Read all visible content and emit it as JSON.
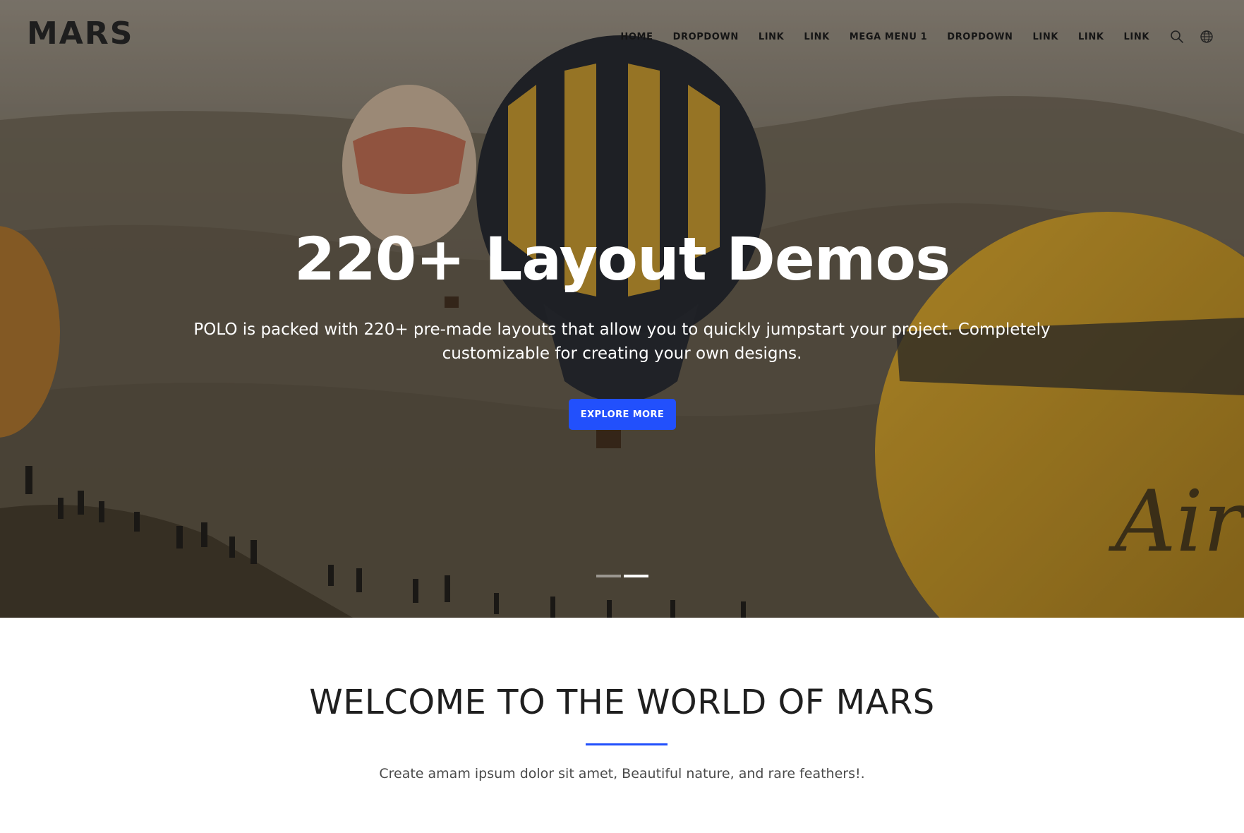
{
  "brand": {
    "logo": "MARS",
    "accent": "#2250fc"
  },
  "nav": {
    "items": [
      "HOME",
      "DROPDOWN",
      "LINK",
      "LINK",
      "MEGA MENU 1",
      "DROPDOWN",
      "LINK",
      "LINK",
      "LINK"
    ],
    "icons": [
      "search-icon",
      "globe-icon"
    ]
  },
  "hero": {
    "title": "220+ Layout Demos",
    "subtitle_line1": "POLO is packed with 220+ pre-made layouts that allow you to quickly jumpstart your project. Completely",
    "subtitle_line2": "customizable for creating your own designs.",
    "button_label": "EXPLORE MORE",
    "slides": 2,
    "active_slide": 2
  },
  "welcome": {
    "title": "WELCOME TO THE WORLD OF MARS",
    "text": "Create amam ipsum dolor sit amet, Beautiful nature, and rare feathers!."
  }
}
